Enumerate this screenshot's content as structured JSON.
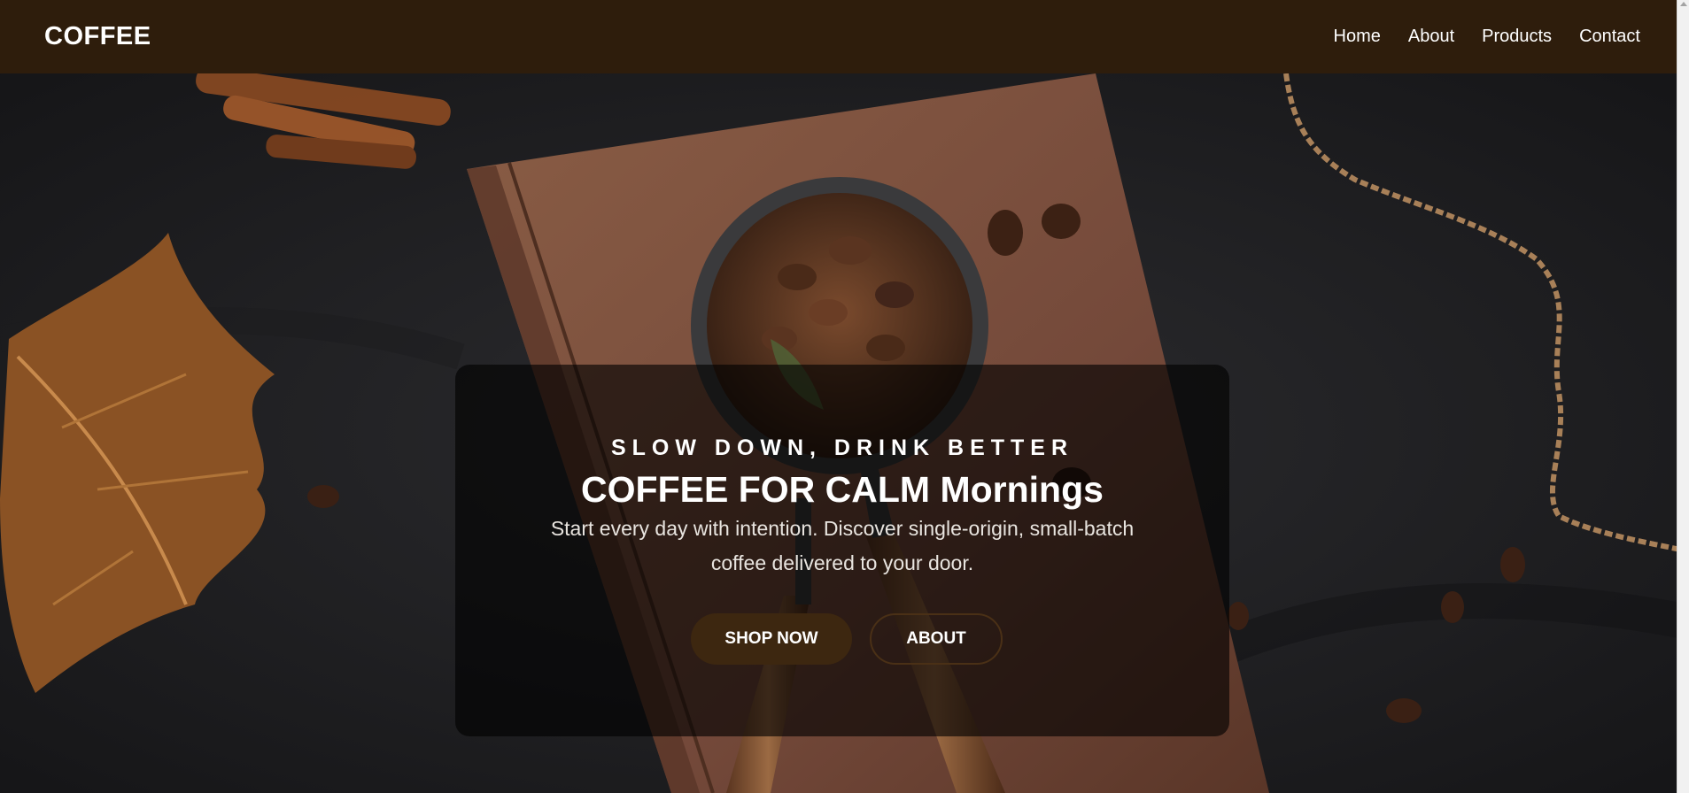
{
  "navbar": {
    "brand": "COFFEE",
    "links": [
      "Home",
      "About",
      "Products",
      "Contact"
    ],
    "background": "#2e1d0c"
  },
  "hero": {
    "eyebrow": "SLOW DOWN, DRINK BETTER",
    "headline": "COFFEE FOR CALM Mornings",
    "subtext": "Start every day with intention. Discover single-origin, small-batch coffee delivered to your door.",
    "primary_button": "SHOP NOW",
    "secondary_button": "ABOUT",
    "accent_color": "#3d2710",
    "background_image": "coffee beans in scoop on brown notebook with autumn leaves, cinnamon sticks and twine on dark cloth"
  }
}
